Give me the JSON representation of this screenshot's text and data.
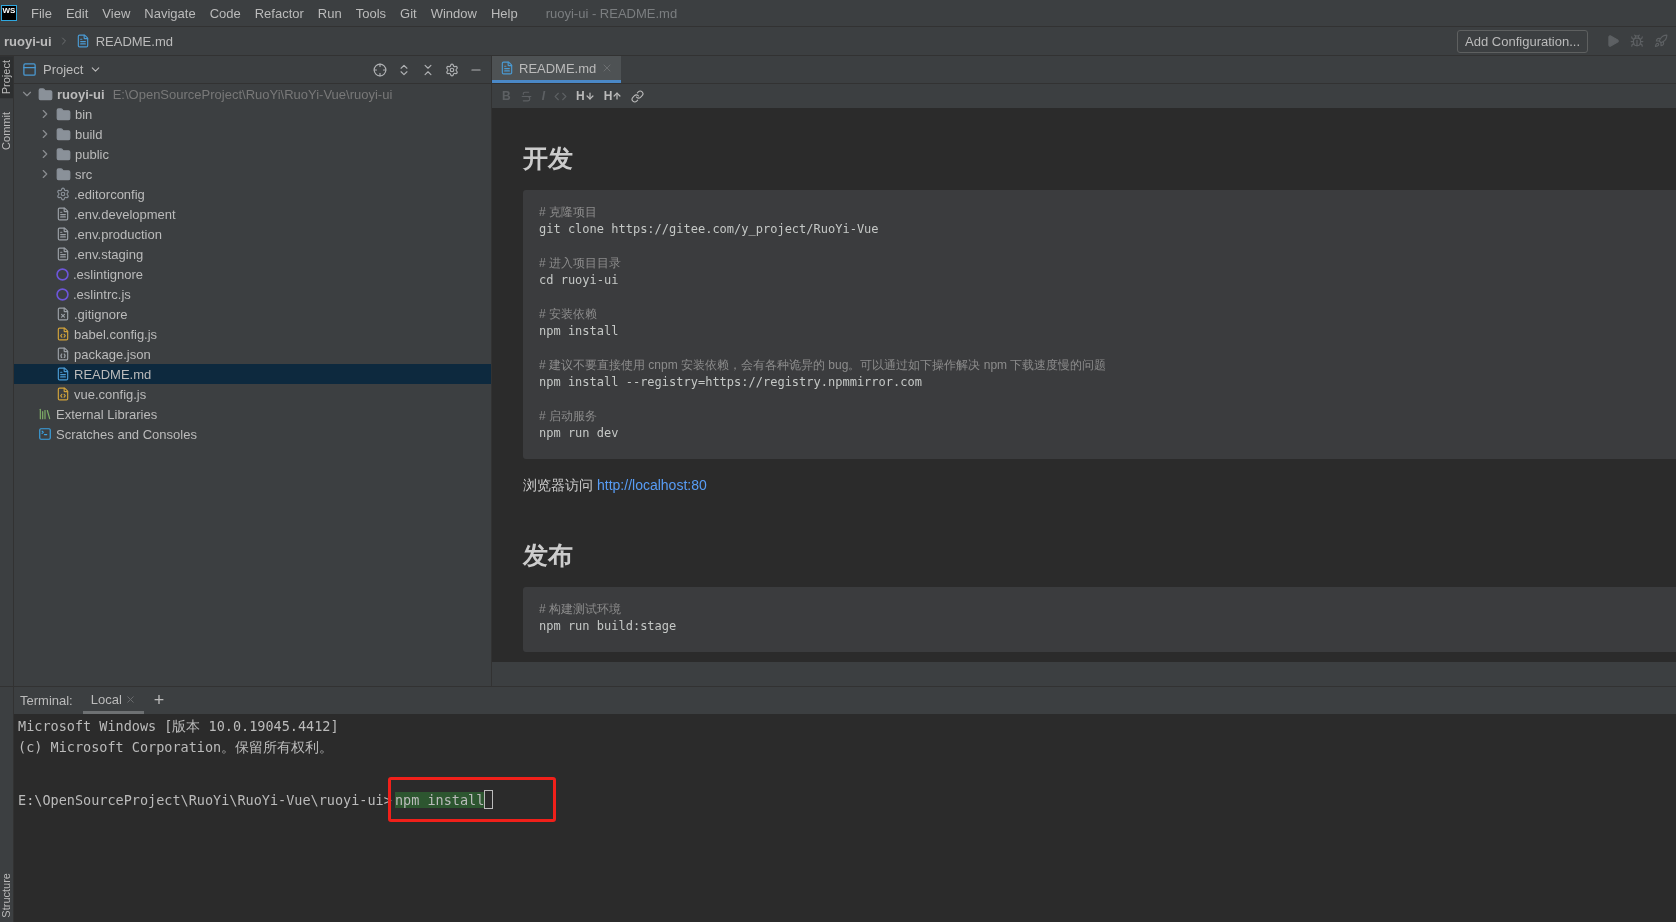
{
  "menu": {
    "logo": "WS",
    "items": [
      "File",
      "Edit",
      "View",
      "Navigate",
      "Code",
      "Refactor",
      "Run",
      "Tools",
      "Git",
      "Window",
      "Help"
    ],
    "title": "ruoyi-ui - README.md"
  },
  "breadcrumb": [
    {
      "label": "ruoyi-ui",
      "kind": "project"
    },
    {
      "label": "README.md",
      "kind": "md"
    }
  ],
  "run_toolbar": {
    "button": "Add Configuration..."
  },
  "side_tabs": {
    "top": [
      {
        "label": "Project",
        "selected": true
      },
      {
        "label": "Commit",
        "selected": false
      }
    ],
    "bottom": [
      {
        "label": "Structure",
        "selected": false
      }
    ]
  },
  "project_panel": {
    "title": "Project",
    "tree": [
      {
        "label": "ruoyi-ui",
        "path": "E:\\OpenSourceProject\\RuoYi\\RuoYi-Vue\\ruoyi-ui",
        "kind": "root",
        "expanded": true,
        "selected": false,
        "children": [
          {
            "label": "bin",
            "kind": "folder",
            "expanded": false,
            "selected": false
          },
          {
            "label": "build",
            "kind": "folder",
            "expanded": false,
            "selected": false
          },
          {
            "label": "public",
            "kind": "folder",
            "expanded": false,
            "selected": false
          },
          {
            "label": "src",
            "kind": "folder",
            "expanded": false,
            "selected": false
          },
          {
            "label": ".editorconfig",
            "kind": "config",
            "selected": false
          },
          {
            "label": ".env.development",
            "kind": "text",
            "selected": false
          },
          {
            "label": ".env.production",
            "kind": "text",
            "selected": false
          },
          {
            "label": ".env.staging",
            "kind": "text",
            "selected": false
          },
          {
            "label": ".eslintignore",
            "kind": "eslint",
            "selected": false
          },
          {
            "label": ".eslintrc.js",
            "kind": "eslint",
            "selected": false
          },
          {
            "label": ".gitignore",
            "kind": "ignore",
            "selected": false
          },
          {
            "label": "babel.config.js",
            "kind": "js",
            "selected": false
          },
          {
            "label": "package.json",
            "kind": "json",
            "selected": false
          },
          {
            "label": "README.md",
            "kind": "md",
            "selected": true
          },
          {
            "label": "vue.config.js",
            "kind": "js",
            "selected": false
          }
        ]
      },
      {
        "label": "External Libraries",
        "kind": "libraries",
        "selected": false
      },
      {
        "label": "Scratches and Consoles",
        "kind": "scratches",
        "selected": false
      }
    ]
  },
  "editor": {
    "tabs": [
      {
        "label": "README.md",
        "selected": true
      }
    ],
    "format_buttons": [
      {
        "kind": "bold",
        "label": "B",
        "disabled": true
      },
      {
        "kind": "strike",
        "disabled": true
      },
      {
        "kind": "italic",
        "label": "I",
        "disabled": true
      },
      {
        "kind": "code",
        "disabled": true
      },
      {
        "kind": "h-down",
        "label": "H",
        "disabled": false
      },
      {
        "kind": "h-up",
        "label": "H",
        "disabled": false
      },
      {
        "kind": "link",
        "disabled": false
      }
    ],
    "sections": [
      {
        "heading": "开发",
        "blocks": [
          {
            "kind": "code",
            "groups": [
              [
                {
                  "kind": "comment",
                  "text": "# 克隆项目"
                },
                {
                  "kind": "command",
                  "text": "git clone https://gitee.com/y_project/RuoYi-Vue"
                }
              ],
              [
                {
                  "kind": "comment",
                  "text": "# 进入项目目录"
                },
                {
                  "kind": "command",
                  "text": "cd ruoyi-ui"
                }
              ],
              [
                {
                  "kind": "comment",
                  "text": "# 安装依赖"
                },
                {
                  "kind": "command",
                  "text": "npm install"
                }
              ],
              [
                {
                  "kind": "comment",
                  "text": "# 建议不要直接使用 cnpm 安装依赖，会有各种诡异的 bug。可以通过如下操作解决 npm 下载速度慢的问题"
                },
                {
                  "kind": "command",
                  "text": "npm install --registry=https://registry.npmmirror.com"
                }
              ],
              [
                {
                  "kind": "comment",
                  "text": "# 启动服务"
                },
                {
                  "kind": "command",
                  "text": "npm run dev"
                }
              ]
            ]
          },
          {
            "kind": "paragraph",
            "text": "浏览器访问",
            "link": "http://localhost:80"
          }
        ]
      },
      {
        "heading": "发布",
        "blocks": [
          {
            "kind": "code",
            "groups": [
              [
                {
                  "kind": "comment",
                  "text": "# 构建测试环境"
                },
                {
                  "kind": "command",
                  "text": "npm run build:stage"
                }
              ]
            ]
          }
        ]
      }
    ]
  },
  "terminal": {
    "label": "Terminal:",
    "tabs": [
      {
        "label": "Local",
        "selected": true
      }
    ],
    "add": "+",
    "lines": [
      "Microsoft Windows [版本 10.0.19045.4412]",
      "(c) Microsoft Corporation。保留所有权利。"
    ],
    "prompt": "E:\\OpenSourceProject\\RuoYi\\RuoYi-Vue\\ruoyi-ui>",
    "input": "npm install",
    "highlighted": true
  }
}
